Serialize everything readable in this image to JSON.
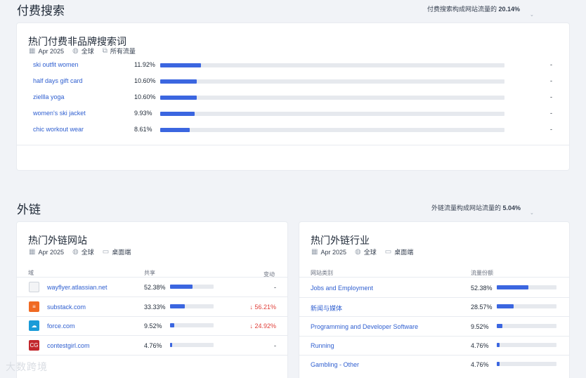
{
  "paid_section": {
    "title": "付费搜索",
    "share_label": "付费搜索构成网站流量的",
    "share_value": "20.14%",
    "card": {
      "title": "热门付费非品牌搜索词",
      "date": "Apr 2025",
      "region": "全球",
      "traffic": "所有流量",
      "keywords": [
        {
          "term": "ski outfit women",
          "pct": "11.92%",
          "share": 0.1192,
          "extra": "-"
        },
        {
          "term": "half days gift card",
          "pct": "10.60%",
          "share": 0.106,
          "extra": "-"
        },
        {
          "term": "ziellla yoga",
          "pct": "10.60%",
          "share": 0.106,
          "extra": "-"
        },
        {
          "term": "women's ski jacket",
          "pct": "9.93%",
          "share": 0.0993,
          "extra": "-"
        },
        {
          "term": "chic workout wear",
          "pct": "8.61%",
          "share": 0.0861,
          "extra": "-"
        }
      ]
    }
  },
  "outlinks_section": {
    "title": "外链",
    "share_label": "外链流量构成网站流量的",
    "share_value": "5.04%",
    "sites_card": {
      "title": "热门外链网站",
      "date": "Apr 2025",
      "region": "全球",
      "device": "桌面端",
      "col_domain": "域",
      "col_share": "共享",
      "col_change": "变动",
      "rows": [
        {
          "domain": "wayflyer.atlassian.net",
          "pct": "52.38%",
          "share": 0.5238,
          "change": "-",
          "direction": "none",
          "icon": "page-icon",
          "icon_color": "#e5e7eb",
          "icon_glyph": ""
        },
        {
          "domain": "substack.com",
          "pct": "33.33%",
          "share": 0.3333,
          "change": "56.21%",
          "direction": "down",
          "icon": "substack-icon",
          "icon_color": "#f06a23",
          "icon_glyph": "≡"
        },
        {
          "domain": "force.com",
          "pct": "9.52%",
          "share": 0.0952,
          "change": "24.92%",
          "direction": "down",
          "icon": "salesforce-icon",
          "icon_color": "#1a9bd8",
          "icon_glyph": "☁"
        },
        {
          "domain": "contestgirl.com",
          "pct": "4.76%",
          "share": 0.0476,
          "change": "-",
          "direction": "none",
          "icon": "contestgirl-icon",
          "icon_color": "#c2272d",
          "icon_glyph": "CG"
        }
      ]
    },
    "industries_card": {
      "title": "热门外链行业",
      "date": "Apr 2025",
      "region": "全球",
      "device": "桌面端",
      "col_category": "网站类别",
      "col_share": "流量份额",
      "rows": [
        {
          "name": "Jobs and Employment",
          "pct": "52.38%",
          "share": 0.5238
        },
        {
          "name": "新闻与媒体",
          "pct": "28.57%",
          "share": 0.2857
        },
        {
          "name": "Programming and Developer Software",
          "pct": "9.52%",
          "share": 0.0952
        },
        {
          "name": "Running",
          "pct": "4.76%",
          "share": 0.0476
        },
        {
          "name": "Gambling - Other",
          "pct": "4.76%",
          "share": 0.0476
        }
      ]
    }
  },
  "watermark": "大数跨境",
  "colors": {
    "bar": "#3b66e0",
    "track": "#e6e9ee",
    "link": "#2f5fd0",
    "down": "#e0403a"
  }
}
